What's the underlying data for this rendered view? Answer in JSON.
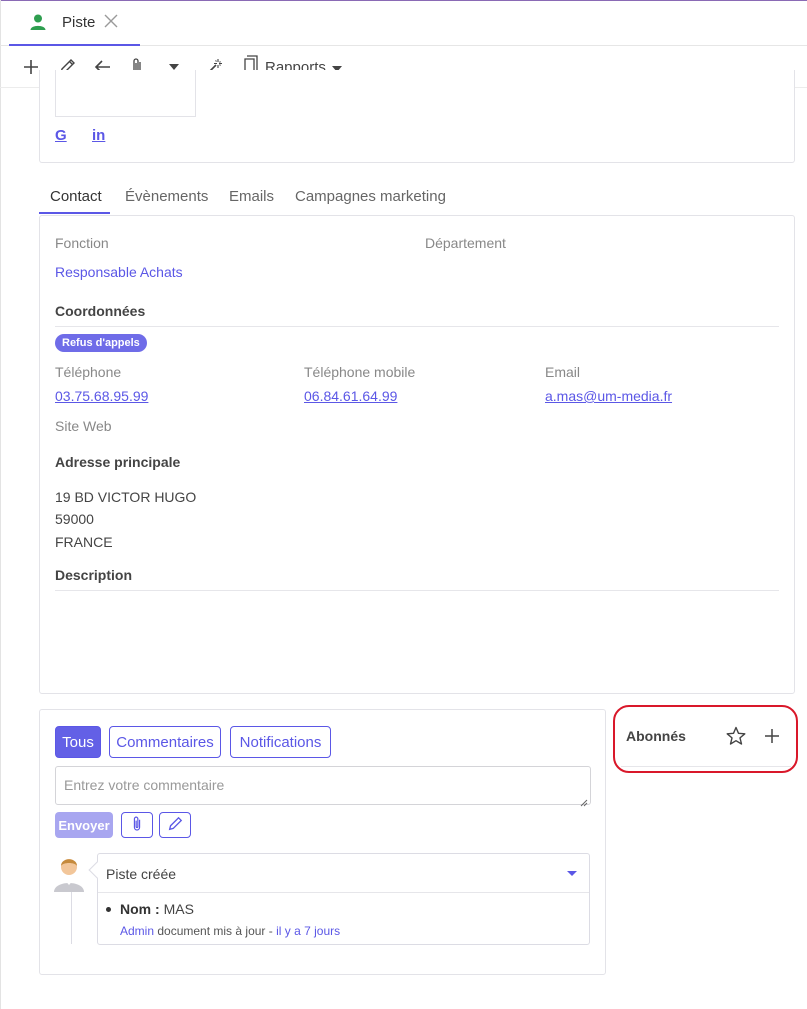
{
  "tab": {
    "label": "Piste",
    "icon": "person-icon"
  },
  "toolbar": {
    "icons": [
      "plus-icon",
      "pencil-icon",
      "arrow-left-icon",
      "paperclip-icon",
      "caret-down-icon",
      "magic-wand-icon",
      "document-icon"
    ],
    "reports_label": "Rapports"
  },
  "social": {
    "google": "G",
    "linkedin": "in"
  },
  "main_tabs": [
    "Contact",
    "Évènements",
    "Emails",
    "Campagnes marketing"
  ],
  "contact": {
    "fonction_label": "Fonction",
    "fonction_value": "Responsable Achats",
    "departement_label": "Département",
    "coordonnees_title": "Coordonnées",
    "badge": "Refus d'appels",
    "telephone_label": "Téléphone",
    "telephone_value": "03.75.68.95.99",
    "mobile_label": "Téléphone mobile",
    "mobile_value": "06.84.61.64.99",
    "email_label": "Email",
    "email_value": "a.mas@um-media.fr",
    "site_label": "Site Web",
    "adresse_title": "Adresse principale",
    "adresse_line1": "19 BD VICTOR HUGO",
    "adresse_line2": "59000",
    "adresse_line3": "FRANCE",
    "description_title": "Description"
  },
  "chatter": {
    "filters": [
      "Tous",
      "Commentaires",
      "Notifications"
    ],
    "comment_placeholder": "Entrez votre commentaire",
    "send_label": "Envoyer",
    "message": {
      "title": "Piste créée",
      "field_name": "Nom :",
      "field_value": "MAS",
      "author": "Admin",
      "action": "document mis à jour -",
      "time": "il y a 7 jours"
    }
  },
  "followers": {
    "label": "Abonnés"
  },
  "colors": {
    "accent": "#5b57e6",
    "highlight": "#d9182a",
    "person": "#2e9e4f"
  }
}
